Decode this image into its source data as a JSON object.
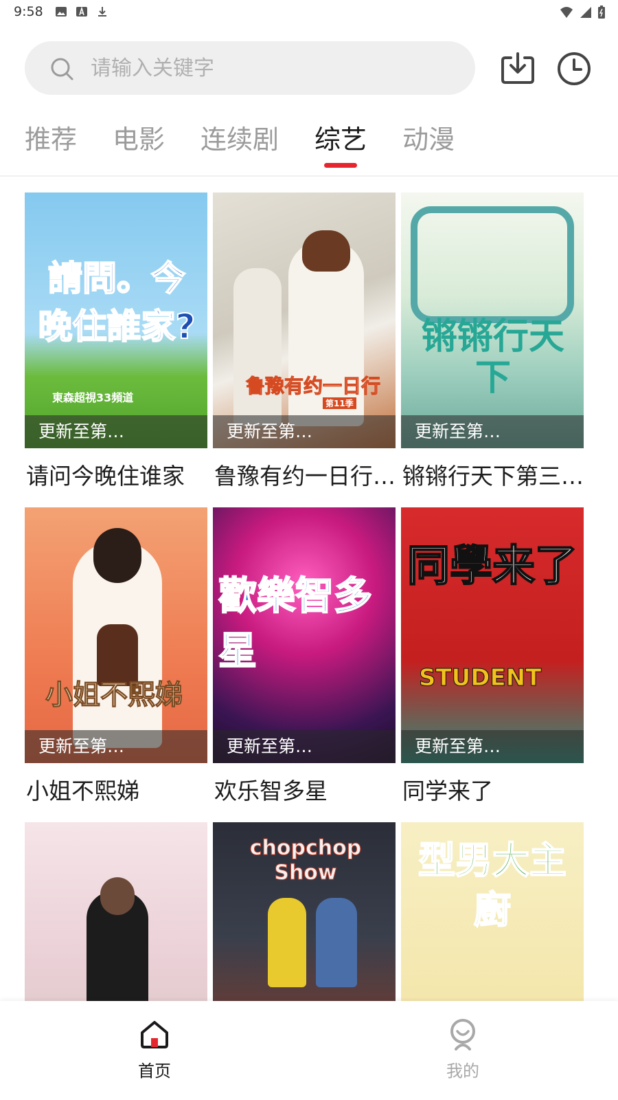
{
  "status_bar": {
    "time": "9:58",
    "left_icons": [
      "image-icon",
      "font-icon",
      "download-icon"
    ],
    "right_icons": [
      "wifi-icon",
      "signal-icon",
      "battery-icon"
    ]
  },
  "header": {
    "search_placeholder": "请输入关键字",
    "download_icon": "download-tray-icon",
    "history_icon": "clock-icon"
  },
  "tabs": [
    {
      "label": "推荐",
      "active": false
    },
    {
      "label": "电影",
      "active": false
    },
    {
      "label": "连续剧",
      "active": false
    },
    {
      "label": "综艺",
      "active": true
    },
    {
      "label": "动漫",
      "active": false
    }
  ],
  "accent_color": "#e6262f",
  "grid": {
    "items": [
      {
        "title": "请问今晚住谁家",
        "badge": "更新至第…",
        "poster_text": "請問。今晚住誰家?",
        "poster_sub": "東森超視33頻道",
        "colors": [
          "#7fc3ec",
          "#5fb335"
        ]
      },
      {
        "title": "鲁豫有约一日行…",
        "badge": "更新至第…",
        "poster_text": "鲁豫有约一日行",
        "poster_sub": "第11季",
        "colors": [
          "#d8d4cc",
          "#c77b4a"
        ]
      },
      {
        "title": "锵锵行天下第三…",
        "badge": "更新至第…",
        "poster_text": "锵锵行天下",
        "poster_sub": "",
        "colors": [
          "#e9f3ee",
          "#3aa796"
        ]
      },
      {
        "title": "小姐不熙娣",
        "badge": "更新至第…",
        "poster_text": "小姐不熙娣",
        "poster_sub": "",
        "colors": [
          "#f49b6d",
          "#ef6d48"
        ]
      },
      {
        "title": "欢乐智多星",
        "badge": "更新至第…",
        "poster_text": "歡樂智多星",
        "poster_sub": "",
        "colors": [
          "#d81f8a",
          "#3a1552"
        ]
      },
      {
        "title": "同学来了",
        "badge": "更新至第…",
        "poster_text": "同學来了",
        "poster_sub": "STUDENT",
        "colors": [
          "#d8262a",
          "#2f8d7a"
        ]
      },
      {
        "title": "",
        "badge": "",
        "poster_text": "",
        "poster_sub": "",
        "colors": [
          "#f0dbe0",
          "#2a2a2a"
        ]
      },
      {
        "title": "",
        "badge": "",
        "poster_text": "chopchop Show",
        "poster_sub": "",
        "colors": [
          "#2a2d36",
          "#b34d2b"
        ]
      },
      {
        "title": "",
        "badge": "",
        "poster_text": "型男大主廚",
        "poster_sub": "",
        "colors": [
          "#f6e6a8",
          "#e89030"
        ]
      }
    ]
  },
  "bottom_nav": {
    "home_label": "首页",
    "mine_label": "我的"
  }
}
